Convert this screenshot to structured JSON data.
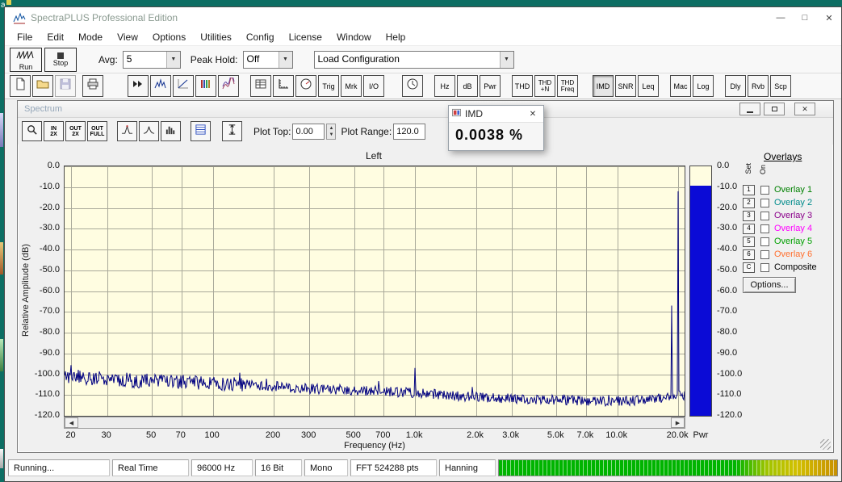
{
  "desktop": {
    "corner_label": "a"
  },
  "icons": {
    "dropdown": "▼",
    "up": "▲",
    "down": "▼",
    "scroll_left": "◀",
    "scroll_right": "▶",
    "close": "✕",
    "minimize": "—",
    "maximize": "□"
  },
  "window": {
    "title": "SpectraPLUS Professional Edition",
    "controls": {
      "minimize": "—",
      "maximize": "□",
      "close": "✕"
    }
  },
  "menu": {
    "items": [
      "File",
      "Edit",
      "Mode",
      "View",
      "Options",
      "Utilities",
      "Config",
      "License",
      "Window",
      "Help"
    ]
  },
  "toolbar_main": {
    "run_label": "Run",
    "stop_label": "Stop",
    "avg_label": "Avg:",
    "avg_value": "5",
    "peak_hold_label": "Peak Hold:",
    "peak_hold_value": "Off",
    "load_config_value": "Load Configuration"
  },
  "toolbar_icons": {
    "buttons": [
      {
        "name": "new-file",
        "icon": "page"
      },
      {
        "name": "open-file",
        "icon": "folder"
      },
      {
        "name": "save-file",
        "icon": "disk",
        "disabled": true
      },
      {
        "name": "print",
        "icon": "printer",
        "gap": 6
      },
      {
        "name": "fast-forward",
        "icon": "ffwd",
        "gap": 28
      },
      {
        "name": "spectrum-view",
        "icon": "spectrum"
      },
      {
        "name": "phase-view",
        "icon": "phase"
      },
      {
        "name": "spectrogram-view",
        "icon": "spectrogram"
      },
      {
        "name": "surface-view",
        "icon": "surface"
      },
      {
        "name": "data-table",
        "icon": "table",
        "gap": 12
      },
      {
        "name": "axis-scale",
        "icon": "scale"
      },
      {
        "name": "dial-meter",
        "icon": "dial"
      },
      {
        "name": "trigger",
        "text": [
          "Trig"
        ]
      },
      {
        "name": "markers",
        "text": [
          "Mrk"
        ]
      },
      {
        "name": "input-output",
        "text": [
          "I/O"
        ]
      },
      {
        "name": "timer",
        "icon": "clock",
        "gap": 20
      },
      {
        "name": "hz-units",
        "text": [
          "Hz"
        ],
        "gap": 12
      },
      {
        "name": "db-units",
        "text": [
          "dB"
        ]
      },
      {
        "name": "power-units",
        "text": [
          "Pwr"
        ]
      },
      {
        "name": "thd",
        "text": [
          "THD"
        ],
        "gap": 12
      },
      {
        "name": "thd-n",
        "text": [
          "THD",
          "+N"
        ]
      },
      {
        "name": "thd-freq",
        "text": [
          "THD",
          "Freq"
        ]
      },
      {
        "name": "imd",
        "text": [
          "IMD"
        ],
        "gap": 16,
        "active": true
      },
      {
        "name": "snr",
        "text": [
          "SNR"
        ]
      },
      {
        "name": "leq",
        "text": [
          "Leq"
        ]
      },
      {
        "name": "macro",
        "text": [
          "Mac"
        ],
        "gap": 12
      },
      {
        "name": "log",
        "text": [
          "Log"
        ]
      },
      {
        "name": "delay",
        "text": [
          "Dly"
        ],
        "gap": 12
      },
      {
        "name": "reverb",
        "text": [
          "Rvb"
        ]
      },
      {
        "name": "scope",
        "text": [
          "Scp"
        ]
      }
    ]
  },
  "spectrum_window": {
    "title": "Spectrum",
    "toolbar_buttons": [
      {
        "name": "zoom",
        "icon": "magnifier"
      },
      {
        "name": "zoom-in-2x",
        "text": [
          "IN",
          "2X"
        ]
      },
      {
        "name": "zoom-out-2x",
        "text": [
          "OUT",
          "2X"
        ]
      },
      {
        "name": "zoom-out-full",
        "text": [
          "OUT",
          "FULL"
        ]
      },
      {
        "name": "peak-display",
        "icon": "peak",
        "gap": 10
      },
      {
        "name": "line-display",
        "icon": "curve"
      },
      {
        "name": "bar-display",
        "icon": "bars"
      },
      {
        "name": "data-grid",
        "icon": "bluegrid",
        "gap": 10
      },
      {
        "name": "plot-cursor",
        "icon": "ibeam",
        "gap": 12
      }
    ],
    "plot_top_label": "Plot Top:",
    "plot_top_value": "0.00",
    "plot_range_label": "Plot Range:",
    "plot_range_value": "120.0",
    "channel_label": "Left",
    "y_axis_title": "Relative Amplitude (dB)",
    "x_axis_title": "Frequency (Hz)",
    "y_tick_labels": [
      "0.0",
      "-10.0",
      "-20.0",
      "-30.0",
      "-40.0",
      "-50.0",
      "-60.0",
      "-70.0",
      "-80.0",
      "-90.0",
      "-100.0",
      "-110.0",
      "-120.0"
    ],
    "x_tick_labels": [
      "20",
      "30",
      "50",
      "70",
      "100",
      "200",
      "300",
      "500",
      "700",
      "1.0k",
      "2.0k",
      "3.0k",
      "5.0k",
      "7.0k",
      "10.0k",
      "20.0k"
    ],
    "pwr_label": "Pwr",
    "overlays": {
      "title": "Overlays",
      "set_label": "Set",
      "on_label": "On",
      "rows": [
        {
          "btn": "1",
          "label": "Overlay 1",
          "color": "#008000"
        },
        {
          "btn": "2",
          "label": "Overlay 2",
          "color": "#008b8b"
        },
        {
          "btn": "3",
          "label": "Overlay 3",
          "color": "#8b008b"
        },
        {
          "btn": "4",
          "label": "Overlay 4",
          "color": "#ff00ff"
        },
        {
          "btn": "5",
          "label": "Overlay 5",
          "color": "#00a000"
        },
        {
          "btn": "6",
          "label": "Overlay 6",
          "color": "#ff7030"
        },
        {
          "btn": "C",
          "label": "Composite",
          "color": "#000000"
        }
      ],
      "options_label": "Options..."
    }
  },
  "imd_window": {
    "title": "IMD",
    "value": "0.0038 %"
  },
  "status_bar": {
    "segments": [
      "Running...",
      "Real Time",
      "96000 Hz",
      "16 Bit",
      "Mono",
      "FFT 524288 pts",
      "Hanning"
    ]
  },
  "colors": {
    "desktop_bg": "#0d6e63",
    "plot_bg": "#fffde1",
    "grid": "#a9a99a",
    "trace": "#000080",
    "power_fill": "#0b0bd6",
    "meter_green": "#00b400",
    "meter_yellow": "#d2c000",
    "meter_orange": "#c89000"
  },
  "chart_data": {
    "type": "line",
    "title": "Left",
    "xlabel": "Frequency (Hz)",
    "ylabel": "Relative Amplitude (dB)",
    "x_scale": "log",
    "xlim": [
      18.5,
      21500
    ],
    "ylim": [
      -120,
      0
    ],
    "x_tick_values": [
      20,
      30,
      50,
      70,
      100,
      200,
      300,
      500,
      700,
      1000,
      2000,
      3000,
      5000,
      7000,
      10000,
      20000
    ],
    "y_tick_values": [
      0,
      -10,
      -20,
      -30,
      -40,
      -50,
      -60,
      -70,
      -80,
      -90,
      -100,
      -110,
      -120
    ],
    "grid": true,
    "line_color": "#000080",
    "noise_floor_db": [
      [
        20,
        -101
      ],
      [
        40,
        -103
      ],
      [
        80,
        -104
      ],
      [
        150,
        -105
      ],
      [
        300,
        -107
      ],
      [
        600,
        -108
      ],
      [
        1000,
        -109
      ],
      [
        2000,
        -111
      ],
      [
        4000,
        -112
      ],
      [
        8000,
        -113
      ],
      [
        14000,
        -112.5
      ],
      [
        21500,
        -110
      ]
    ],
    "noise_jitter_db": 2.4,
    "spikes_hz_db": [
      [
        1000,
        -97
      ],
      [
        18600,
        -67
      ],
      [
        19900,
        -12
      ]
    ],
    "power_bar_level_db": -9.5
  }
}
